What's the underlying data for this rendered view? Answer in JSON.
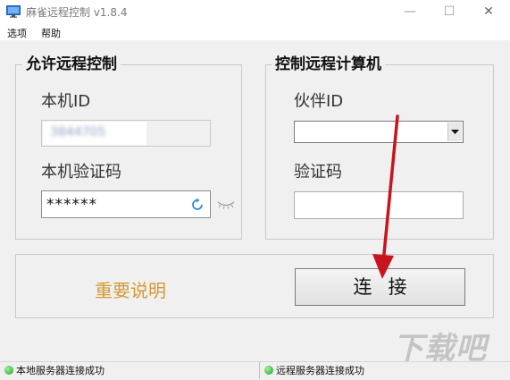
{
  "window": {
    "title": "麻雀远程控制 v1.8.4",
    "minimize_glyph": "—",
    "maximize_glyph": "☐",
    "close_glyph": "✕"
  },
  "menu": {
    "items": [
      {
        "label": "选项"
      },
      {
        "label": "帮助"
      }
    ]
  },
  "allow_panel": {
    "title": "允许远程控制",
    "id_label": "本机ID",
    "id_value": "3844705",
    "verify_label": "本机验证码",
    "verify_value": "******"
  },
  "control_panel": {
    "title": "控制远程计算机",
    "partner_label": "伙伴ID",
    "partner_value": "",
    "code_label": "验证码",
    "code_value": ""
  },
  "actions": {
    "notice_label": "重要说明",
    "connect_label": "连接"
  },
  "status": {
    "local": "本地服务器连接成功",
    "remote": "远程服务器连接成功"
  },
  "watermark": "下载吧",
  "colors": {
    "notice": "#d39a35",
    "arrow": "#c8141c",
    "status_ok": "#1aa11a",
    "refresh_icon": "#2a8fd8"
  },
  "icons": {
    "app": "monitor-icon",
    "refresh": "refresh-icon",
    "hide": "eye-closed-icon",
    "dropdown": "chevron-down-icon"
  }
}
